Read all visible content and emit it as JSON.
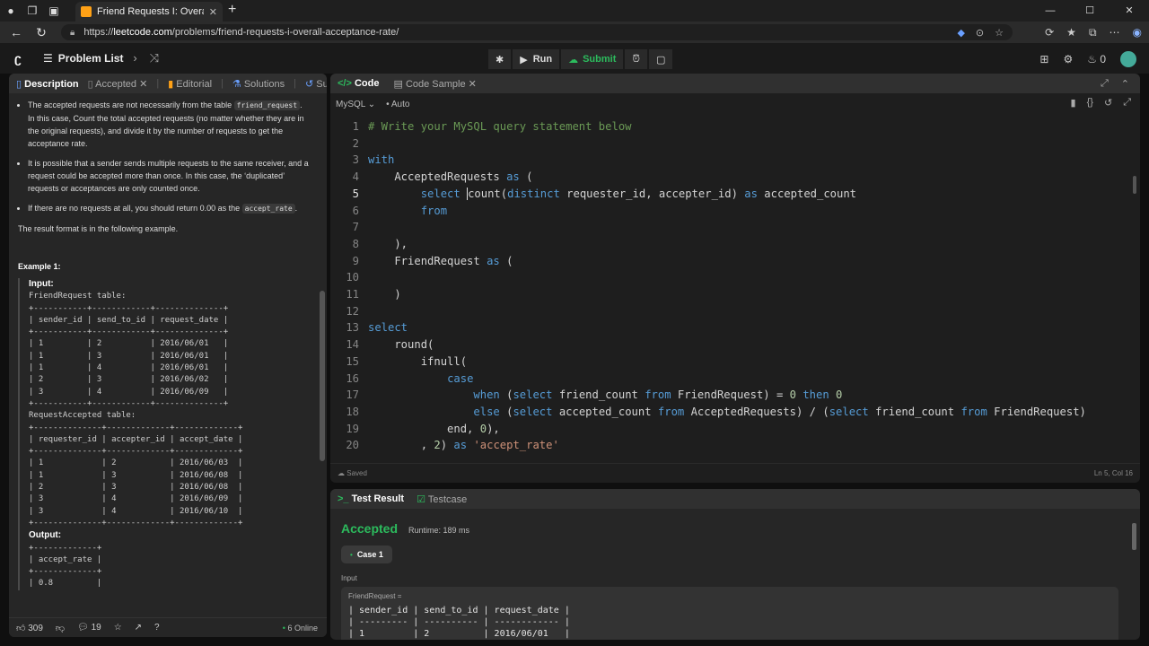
{
  "browser": {
    "tab_title": "Friend Requests I: Overall Acceptance Rate",
    "tab_close": "✕",
    "new_tab": "+",
    "url_prefix": "https://",
    "url_domain": "leetcode.com",
    "url_path": "/problems/friend-requests-i-overall-acceptance-rate/",
    "win_min": "—",
    "win_max": "☐",
    "win_close": "✕"
  },
  "app": {
    "problem_list_label": "Problem List",
    "run_label": "Run",
    "submit_label": "Submit",
    "streak_count": "0"
  },
  "left_tabs": {
    "description": "Description",
    "accepted": "Accepted",
    "editorial": "Editorial",
    "solutions": "Solutions",
    "submissions": "Submission"
  },
  "description": {
    "bullet1_a": "The accepted requests are not necessarily from the table ",
    "bullet1_code": "friend_request",
    "bullet1_b": ". In this case, Count the total accepted requests (no matter whether they are in the original requests), and divide it by the number of requests to get the acceptance rate.",
    "bullet2": "It is possible that a sender sends multiple requests to the same receiver, and a request could be accepted more than once. In this case, the ‘duplicated’ requests or acceptances are only counted once.",
    "bullet3_a": "If there are no requests at all, you should return 0.00 as the ",
    "bullet3_code": "accept_rate",
    "bullet3_b": ".",
    "result_format": "The result format is in the following example.",
    "example_title": "Example 1:",
    "input_label": "Input:",
    "friend_request_table_label": "FriendRequest table:",
    "friend_request_table": "+-----------+------------+--------------+\n| sender_id | send_to_id | request_date |\n+-----------+------------+--------------+\n| 1         | 2          | 2016/06/01   |\n| 1         | 3          | 2016/06/01   |\n| 1         | 4          | 2016/06/01   |\n| 2         | 3          | 2016/06/02   |\n| 3         | 4          | 2016/06/09   |\n+-----------+------------+--------------+",
    "request_accepted_table_label": "RequestAccepted table:",
    "request_accepted_table": "+--------------+-------------+-------------+\n| requester_id | accepter_id | accept_date |\n+--------------+-------------+-------------+\n| 1            | 2           | 2016/06/03  |\n| 1            | 3           | 2016/06/08  |\n| 2            | 3           | 2016/06/08  |\n| 3            | 4           | 2016/06/09  |\n| 3            | 4           | 2016/06/10  |\n+--------------+-------------+-------------+",
    "output_label": "Output:",
    "output_table": "+-------------+\n| accept_rate |\n+-------------+\n| 0.8         |"
  },
  "left_footer": {
    "likes": "309",
    "comments": "19",
    "online": "6 Online"
  },
  "code_tabs": {
    "code": "Code",
    "code_sample": "Code Sample"
  },
  "editor": {
    "language": "MySQL",
    "mode": "Auto",
    "status_left": "Saved",
    "status_right": "Ln 5, Col 16"
  },
  "result_tabs": {
    "test_result": "Test Result",
    "testcase": "Testcase"
  },
  "result": {
    "status": "Accepted",
    "runtime": "Runtime: 189 ms",
    "case_label": "Case 1",
    "input_label": "Input",
    "input_var": "FriendRequest =",
    "input_table": "| sender_id | send_to_id | request_date |\n| --------- | ---------- | ------------ |\n| 1         | 2          | 2016/06/01   |"
  }
}
